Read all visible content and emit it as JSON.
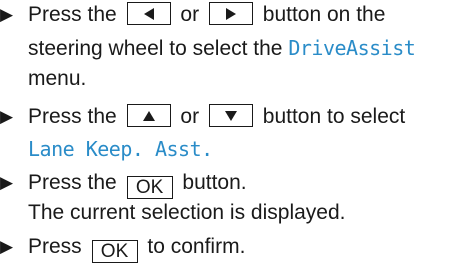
{
  "steps": [
    {
      "line1": {
        "pre": "Press the",
        "mid": "or",
        "post": "button on the"
      },
      "line2": {
        "pre": "steering wheel to select the",
        "term": "DriveAssist"
      },
      "line3": "menu."
    },
    {
      "line1": {
        "pre": "Press the",
        "mid": "or",
        "post": "button to select"
      },
      "line2": {
        "term": "Lane Keep. Asst."
      }
    },
    {
      "line1": {
        "pre": "Press the",
        "key": "OK",
        "post": "button."
      },
      "line2": "The current selection is displayed."
    },
    {
      "line1": {
        "pre": "Press",
        "key": "OK",
        "post": "to confirm."
      }
    }
  ],
  "bullet_glyph": "▶",
  "colors": {
    "text": "#1a1a1a",
    "term": "#2a8cc8"
  },
  "icons": {
    "left": "left-arrow-icon",
    "right": "right-arrow-icon",
    "up": "up-arrow-icon",
    "down": "down-arrow-icon"
  }
}
